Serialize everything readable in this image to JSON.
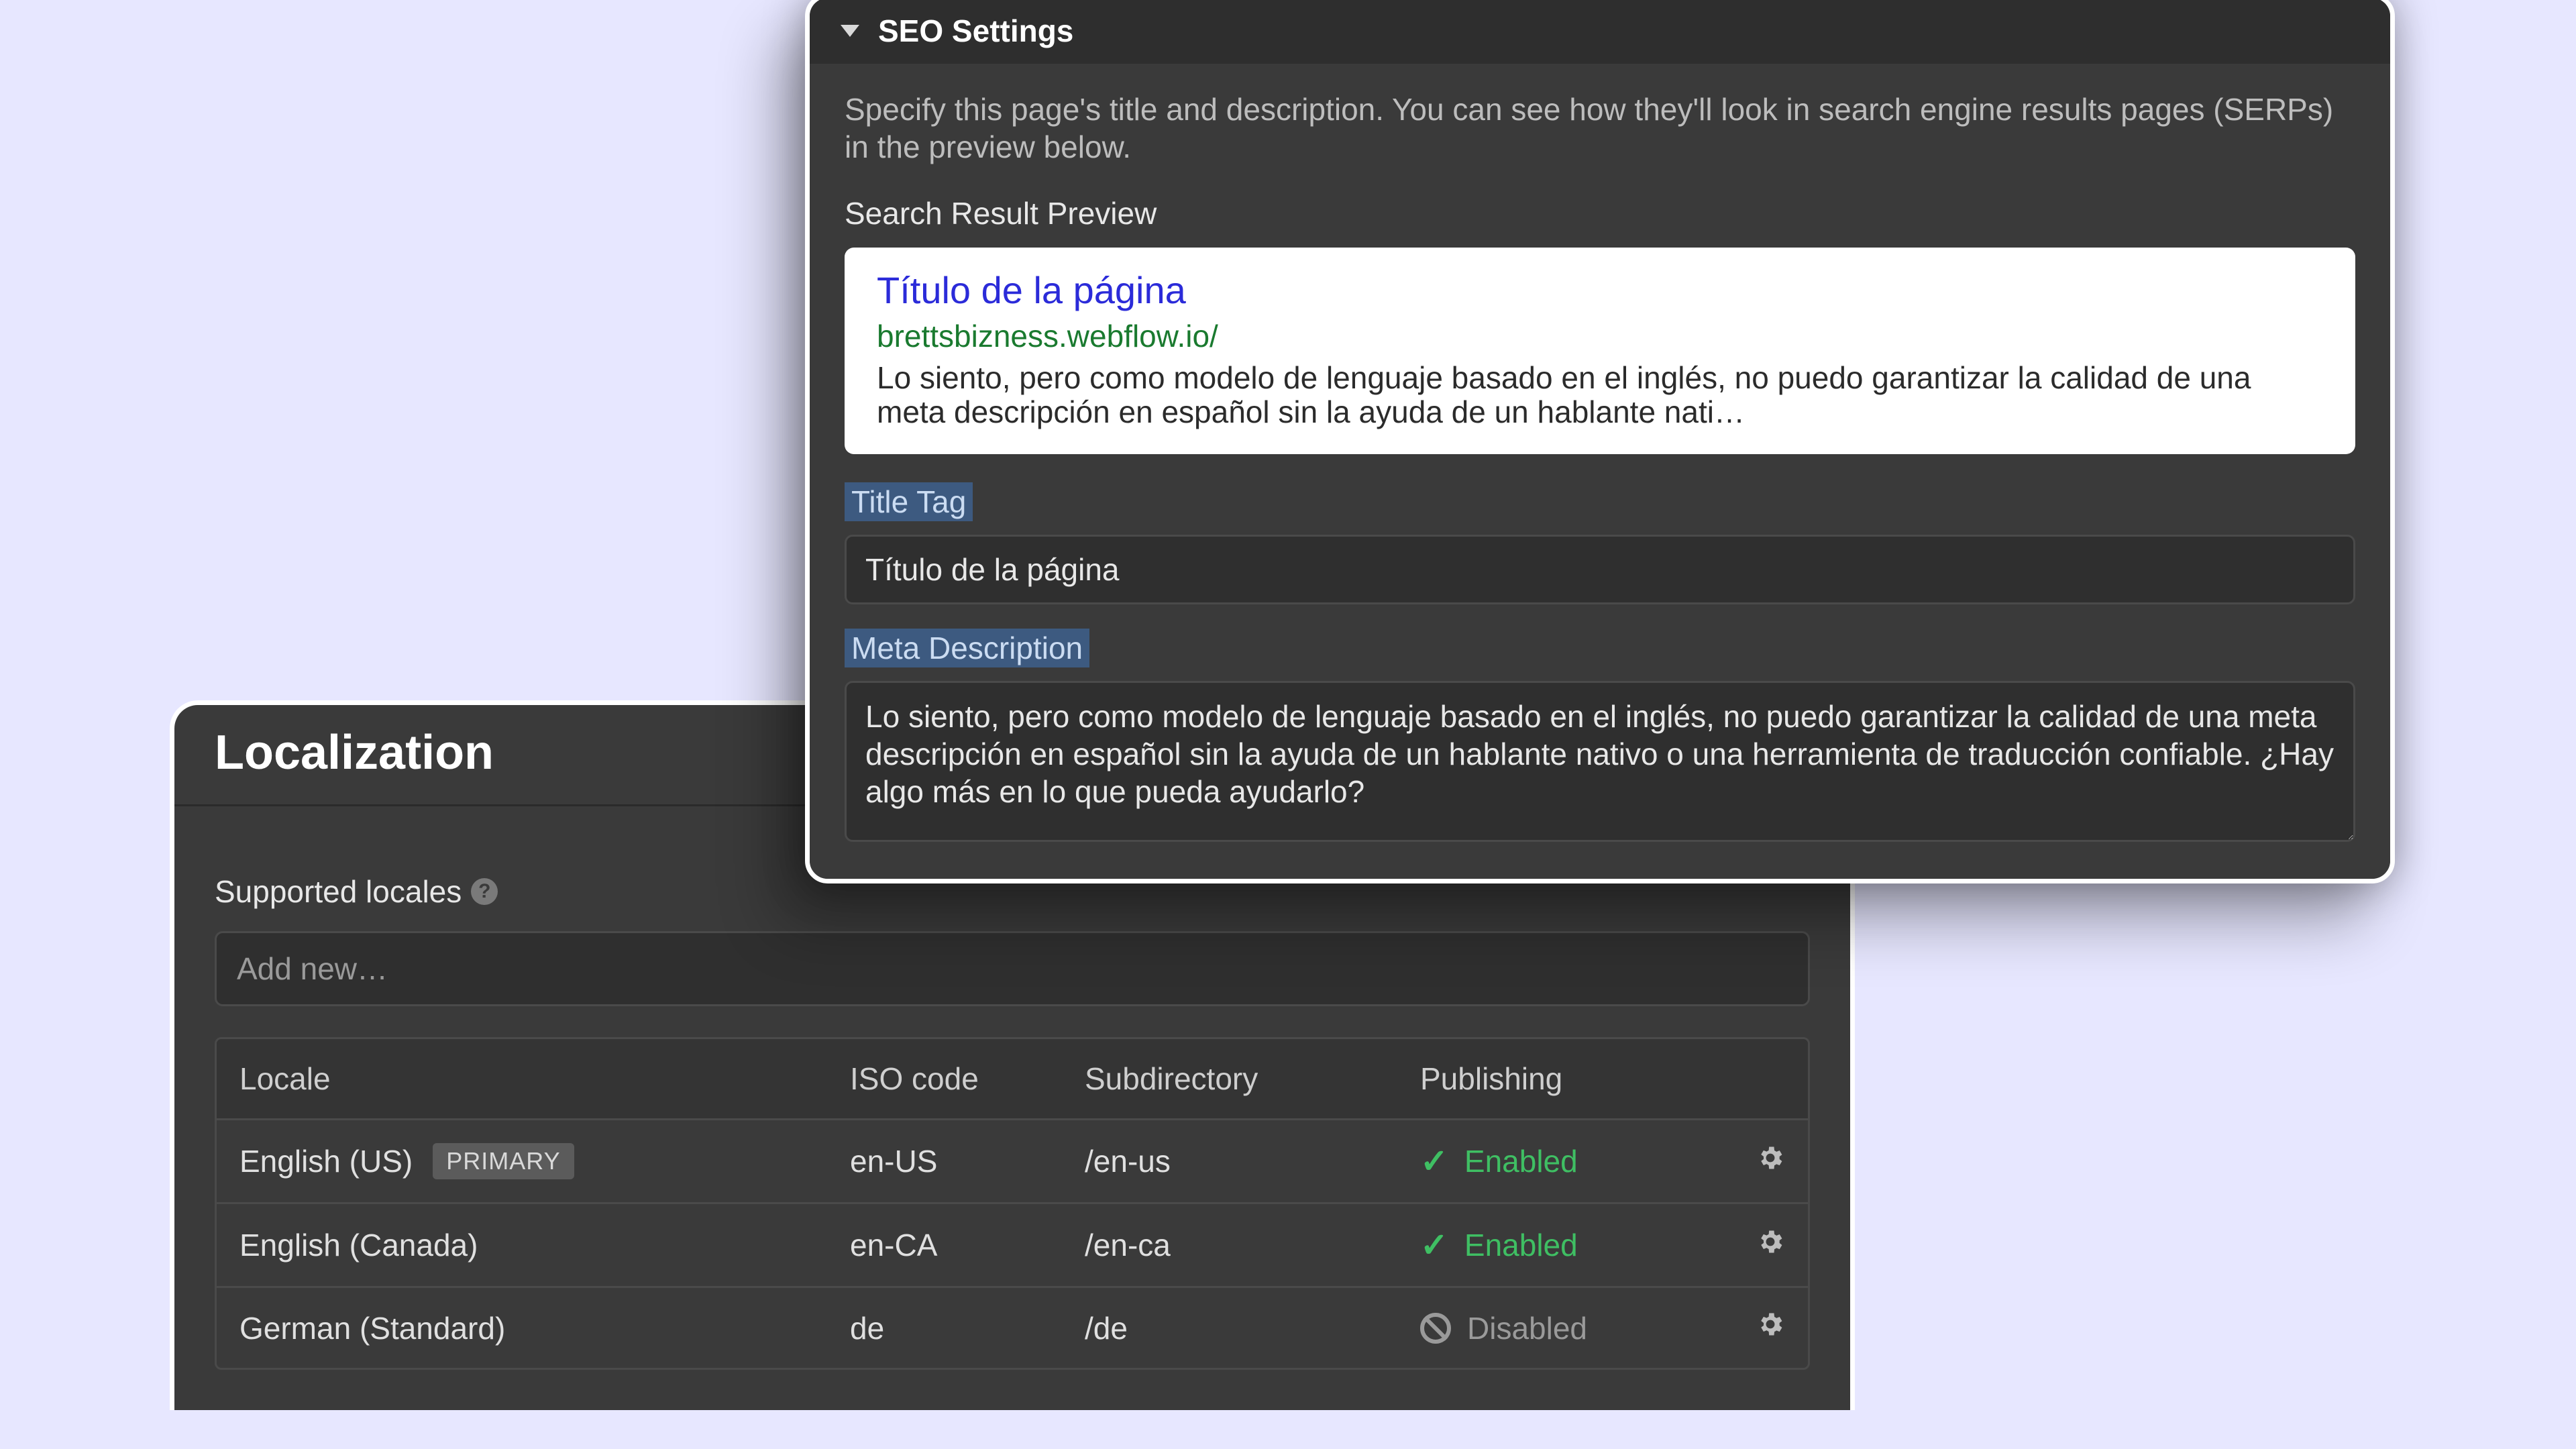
{
  "seo": {
    "header": "SEO Settings",
    "help_text": "Specify this page's title and description. You can see how they'll look in search engine results pages (SERPs) in the preview below.",
    "preview_label": "Search Result Preview",
    "serp": {
      "title": "Título de la página",
      "url": "brettsbizness.webflow.io/",
      "description": "Lo siento, pero como modelo de lenguaje basado en el inglés, no puedo garantizar la calidad de una meta descripción en español sin la ayuda de un hablante nati…"
    },
    "title_tag_label": "Title Tag",
    "title_tag_value": "Título de la página",
    "meta_desc_label": "Meta Description",
    "meta_desc_value": "Lo siento, pero como modelo de lenguaje basado en el inglés, no puedo garantizar la calidad de una meta descripción en español sin la ayuda de un hablante nativo o una herramienta de traducción confiable. ¿Hay algo más en lo que pueda ayudarlo?"
  },
  "localization": {
    "title": "Localization",
    "supported_label": "Supported locales",
    "add_placeholder": "Add new…",
    "columns": {
      "locale": "Locale",
      "iso": "ISO code",
      "subdir": "Subdirectory",
      "publishing": "Publishing"
    },
    "rows": [
      {
        "locale": "English (US)",
        "primary": "PRIMARY",
        "iso": "en-US",
        "subdir": "/en-us",
        "pub_enabled": true,
        "pub_label": "Enabled"
      },
      {
        "locale": "English (Canada)",
        "primary": "",
        "iso": "en-CA",
        "subdir": "/en-ca",
        "pub_enabled": true,
        "pub_label": "Enabled"
      },
      {
        "locale": "German (Standard)",
        "primary": "",
        "iso": "de",
        "subdir": "/de",
        "pub_enabled": false,
        "pub_label": "Disabled"
      }
    ]
  }
}
